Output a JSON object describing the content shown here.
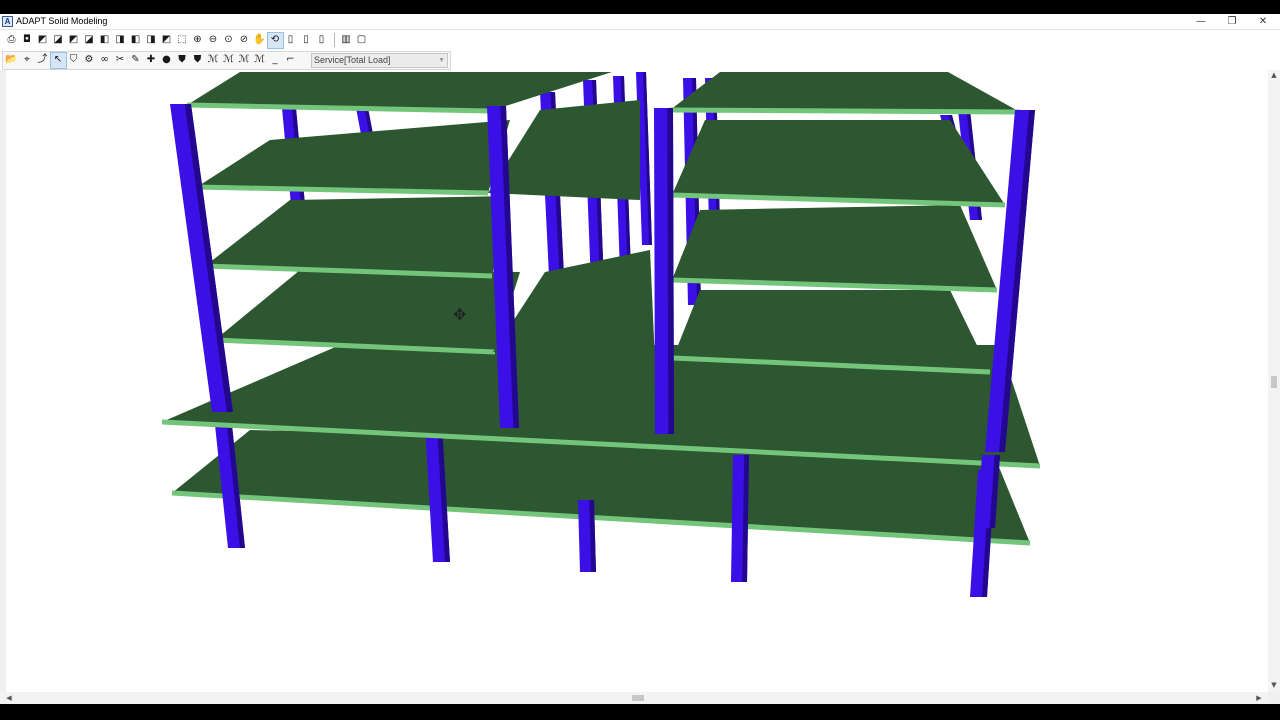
{
  "window": {
    "app_icon_glyph": "A",
    "title": "ADAPT Solid Modeling",
    "controls": {
      "minimize": "—",
      "restore": "❐",
      "close": "✕"
    }
  },
  "toolbar1": {
    "buttons": [
      {
        "name": "print-icon",
        "glyph": "⎙"
      },
      {
        "name": "camera-icon",
        "glyph": "◘"
      },
      {
        "name": "view-iso-1-icon",
        "glyph": "◩"
      },
      {
        "name": "view-iso-2-icon",
        "glyph": "◪"
      },
      {
        "name": "view-iso-3-icon",
        "glyph": "◩"
      },
      {
        "name": "view-iso-4-icon",
        "glyph": "◪"
      },
      {
        "name": "view-front-icon",
        "glyph": "◧"
      },
      {
        "name": "view-back-icon",
        "glyph": "◨"
      },
      {
        "name": "view-left-icon",
        "glyph": "◧"
      },
      {
        "name": "view-right-icon",
        "glyph": "◨"
      },
      {
        "name": "view-top-icon",
        "glyph": "◩"
      },
      {
        "name": "zoom-window-icon",
        "glyph": "⬚"
      },
      {
        "name": "zoom-in-icon",
        "glyph": "⊕"
      },
      {
        "name": "zoom-out-icon",
        "glyph": "⊖"
      },
      {
        "name": "zoom-extents-icon",
        "glyph": "⊙"
      },
      {
        "name": "zoom-previous-icon",
        "glyph": "⊘"
      },
      {
        "name": "pan-hand-icon",
        "glyph": "✋"
      },
      {
        "name": "rotate-icon",
        "glyph": "⟲",
        "active": true
      },
      {
        "name": "column-display-1-icon",
        "glyph": "▯"
      },
      {
        "name": "column-display-2-icon",
        "glyph": "▯"
      },
      {
        "name": "column-display-3-icon",
        "glyph": "▯"
      },
      {
        "sep": true
      },
      {
        "name": "render-mode-icon",
        "glyph": "▥"
      },
      {
        "name": "wireframe-icon",
        "glyph": "▢"
      }
    ]
  },
  "toolbar2": {
    "buttons": [
      {
        "name": "open-folder-icon",
        "glyph": "📂"
      },
      {
        "name": "snap-icon",
        "glyph": "⌖"
      },
      {
        "name": "select-icon",
        "glyph": "⤴"
      },
      {
        "name": "pointer-icon",
        "glyph": "↖",
        "active": true
      },
      {
        "name": "filter-icon",
        "glyph": "⛉"
      },
      {
        "name": "settings-icon",
        "glyph": "⚙"
      },
      {
        "name": "link-icon",
        "glyph": "∞"
      },
      {
        "name": "tools-icon",
        "glyph": "✂"
      },
      {
        "name": "edit-icon",
        "glyph": "✎"
      },
      {
        "name": "move-icon",
        "glyph": "✚"
      },
      {
        "name": "record-icon",
        "glyph": "●"
      },
      {
        "name": "shield-1-icon",
        "glyph": "⛊"
      },
      {
        "name": "shield-2-icon",
        "glyph": "⛊"
      },
      {
        "name": "load-1-icon",
        "glyph": "ℳ"
      },
      {
        "name": "load-2-icon",
        "glyph": "ℳ"
      },
      {
        "name": "load-3-icon",
        "glyph": "ℳ"
      },
      {
        "name": "load-4-icon",
        "glyph": "ℳ"
      },
      {
        "name": "line-icon",
        "glyph": "_"
      },
      {
        "name": "bracket-icon",
        "glyph": "⌐"
      }
    ],
    "load_combo": {
      "value": "Service[Total Load]",
      "arrow": "▼"
    }
  },
  "scrollbars": {
    "up": "▲",
    "down": "▼",
    "left": "◀",
    "right": "▶"
  },
  "colors": {
    "slab": "#2d5730",
    "slab_edge": "#74c57c",
    "column": "#3a10e6",
    "column_dark": "#23088f"
  }
}
